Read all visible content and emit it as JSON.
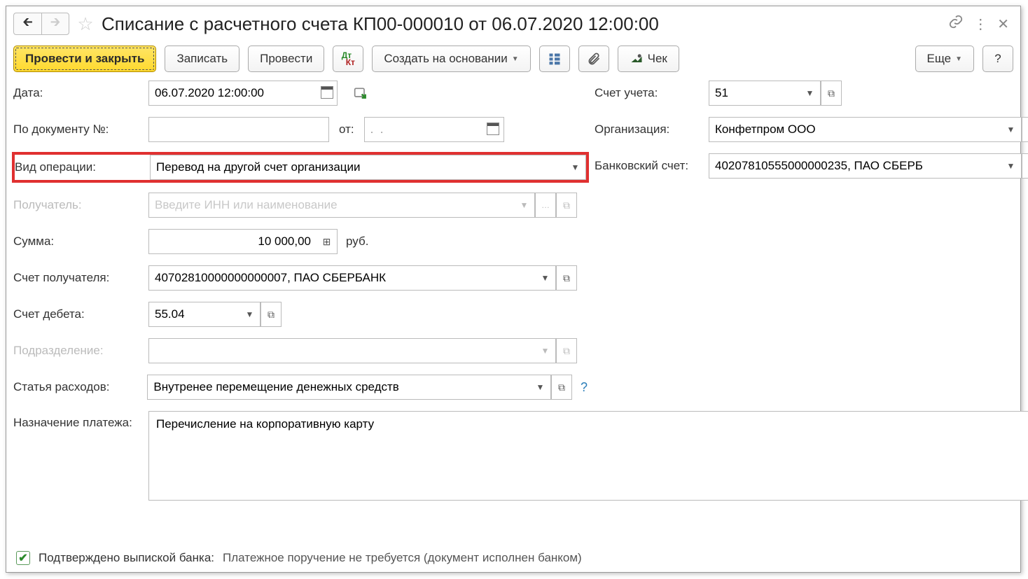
{
  "title": "Списание с расчетного счета КП00-000010 от 06.07.2020 12:00:00",
  "toolbar": {
    "post_close": "Провести и закрыть",
    "save": "Записать",
    "post": "Провести",
    "create_based": "Создать на основании",
    "cheque": "Чек",
    "more": "Еще",
    "help": "?"
  },
  "left": {
    "date_label": "Дата:",
    "date_value": "06.07.2020 12:00:00",
    "docnum_label": "По документу №:",
    "docnum_value": "",
    "docdate_label": "от:",
    "docdate_value": ".  .",
    "optype_label": "Вид операции:",
    "optype_value": "Перевод на другой счет организации",
    "recipient_label": "Получатель:",
    "recipient_placeholder": "Введите ИНН или наименование",
    "amount_label": "Сумма:",
    "amount_value": "10 000,00",
    "currency": "руб.",
    "recip_acct_label": "Счет получателя:",
    "recip_acct_value": "40702810000000000007, ПАО СБЕРБАНК",
    "debit_acct_label": "Счет дебета:",
    "debit_acct_value": "55.04",
    "dept_label": "Подразделение:",
    "dept_value": "",
    "expense_label": "Статья расходов:",
    "expense_value": "Внутренее перемещение денежных средств",
    "purpose_label": "Назначение платежа:",
    "purpose_value": "Перечисление на корпоративную карту"
  },
  "right": {
    "acct_label": "Счет учета:",
    "acct_value": "51",
    "org_label": "Организация:",
    "org_value": "Конфетпром ООО",
    "bank_label": "Банковский счет:",
    "bank_value": "40207810555000000235, ПАО СБЕРБ"
  },
  "footer": {
    "confirmed_label": "Подтверждено выпиской банка:",
    "confirmed_note": "Платежное поручение не требуется (документ исполнен банком)"
  }
}
